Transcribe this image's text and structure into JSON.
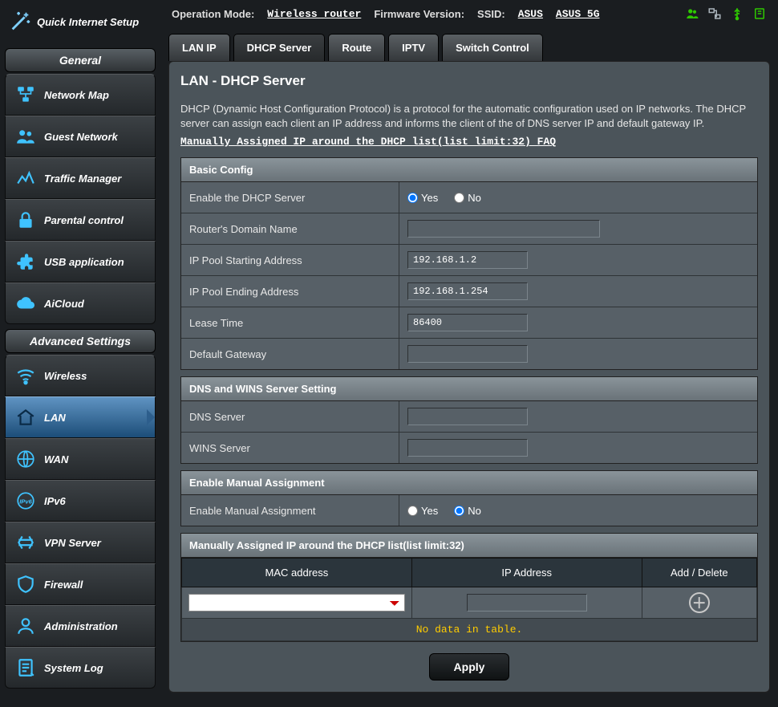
{
  "header": {
    "opmode_lbl": "Operation Mode:",
    "opmode_val": "Wireless router",
    "fwver_lbl": "Firmware Version:",
    "ssid_lbl": "SSID:",
    "ssid_24": "ASUS",
    "ssid_5g": "ASUS_5G"
  },
  "quick_setup": "Quick Internet Setup",
  "section_general": "General",
  "section_advanced": "Advanced Settings",
  "nav_general": [
    "Network Map",
    "Guest Network",
    "Traffic Manager",
    "Parental control",
    "USB application",
    "AiCloud"
  ],
  "nav_advanced": [
    "Wireless",
    "LAN",
    "WAN",
    "IPv6",
    "VPN Server",
    "Firewall",
    "Administration",
    "System Log"
  ],
  "tabs": [
    "LAN IP",
    "DHCP Server",
    "Route",
    "IPTV",
    "Switch Control"
  ],
  "active_tab": 1,
  "page": {
    "title": "LAN - DHCP Server",
    "desc": "DHCP (Dynamic Host Configuration Protocol) is a protocol for the automatic configuration used on IP networks. The DHCP server can assign each client an IP address and informs the client of the of DNS server IP and default gateway IP.",
    "faq_link": "Manually Assigned IP around the DHCP list(list limit:32) FAQ"
  },
  "basic": {
    "title": "Basic Config",
    "enable_lbl": "Enable the DHCP Server",
    "enable_yes": "Yes",
    "enable_no": "No",
    "enable_val": "yes",
    "domain_lbl": "Router's Domain Name",
    "domain_val": "",
    "pool_start_lbl": "IP Pool Starting Address",
    "pool_start_val": "192.168.1.2",
    "pool_end_lbl": "IP Pool Ending Address",
    "pool_end_val": "192.168.1.254",
    "lease_lbl": "Lease Time",
    "lease_val": "86400",
    "gw_lbl": "Default Gateway",
    "gw_val": ""
  },
  "dnswins": {
    "title": "DNS and WINS Server Setting",
    "dns_lbl": "DNS Server",
    "dns_val": "",
    "wins_lbl": "WINS Server",
    "wins_val": ""
  },
  "manual": {
    "title": "Enable Manual Assignment",
    "enable_lbl": "Enable Manual Assignment",
    "enable_yes": "Yes",
    "enable_no": "No",
    "enable_val": "no"
  },
  "assign_table": {
    "title": "Manually Assigned IP around the DHCP list(list limit:32)",
    "col_mac": "MAC address",
    "col_ip": "IP Address",
    "col_act": "Add / Delete",
    "empty": "No data in table."
  },
  "apply": "Apply"
}
